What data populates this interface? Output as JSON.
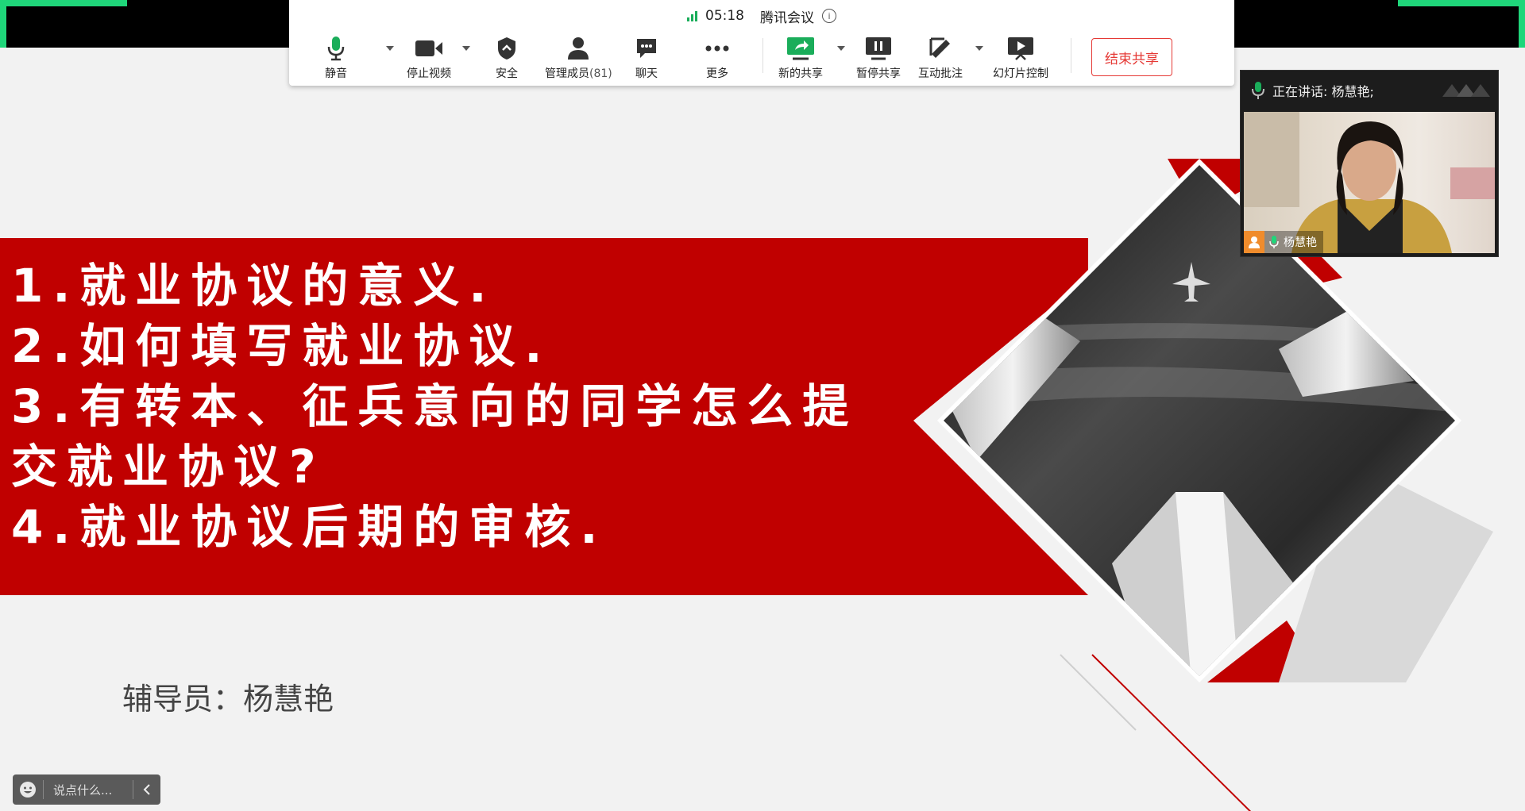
{
  "toolbar": {
    "time": "05:18",
    "app_name": "腾讯会议",
    "buttons": {
      "mute": "静音",
      "stop_video": "停止视频",
      "security": "安全",
      "manage_members": "管理成员",
      "member_count": "(81)",
      "chat": "聊天",
      "more": "更多",
      "new_share": "新的共享",
      "pause_share": "暂停共享",
      "annotate": "互动批注",
      "slide_control": "幻灯片控制"
    },
    "end_share": "结束共享"
  },
  "slide": {
    "lines": [
      "1.就业协议的意义.",
      "2.如何填写就业协议.",
      "3.有转本、征兵意向的同学怎么提",
      "交就业协议?",
      "4.就业协议后期的审核."
    ],
    "counselor": "辅导员：杨慧艳"
  },
  "video_panel": {
    "speaking": "正在讲话: 杨慧艳;",
    "name": "杨慧艳"
  },
  "chat_bar": {
    "placeholder": "说点什么..."
  },
  "colors": {
    "slide_red": "#c00000",
    "accent_green": "#1fd67a",
    "end_share_red": "#e53935"
  }
}
